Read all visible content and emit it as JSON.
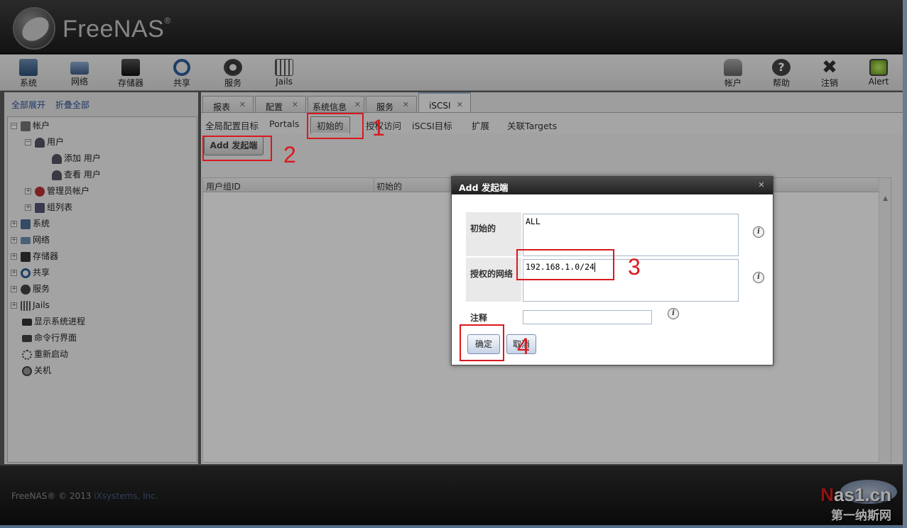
{
  "app": {
    "logo_text": "FreeNAS",
    "logo_reg": "®"
  },
  "toolbar": {
    "left": [
      {
        "label": "系统",
        "icon": "system-icon"
      },
      {
        "label": "网络",
        "icon": "network-icon"
      },
      {
        "label": "存储器",
        "icon": "storage-icon"
      },
      {
        "label": "共享",
        "icon": "sharing-icon"
      },
      {
        "label": "服务",
        "icon": "services-icon"
      },
      {
        "label": "Jails",
        "icon": "jails-icon"
      }
    ],
    "right": [
      {
        "label": "帐户",
        "icon": "account-icon"
      },
      {
        "label": "帮助",
        "icon": "help-icon"
      },
      {
        "label": "注销",
        "icon": "logout-icon"
      },
      {
        "label": "Alert",
        "icon": "alert-icon"
      }
    ]
  },
  "sidebar": {
    "expand_all": "全部展开",
    "collapse_all": "折叠全部",
    "tree": [
      {
        "label": "帐户",
        "toggle": "−"
      },
      {
        "label": "用户",
        "toggle": "−"
      },
      {
        "label": "添加 用户",
        "toggle": ""
      },
      {
        "label": "查看 用户",
        "toggle": ""
      },
      {
        "label": "管理员帐户",
        "toggle": "+"
      },
      {
        "label": "组列表",
        "toggle": "+"
      },
      {
        "label": "系统",
        "toggle": "+"
      },
      {
        "label": "网络",
        "toggle": "+"
      },
      {
        "label": "存储器",
        "toggle": "+"
      },
      {
        "label": "共享",
        "toggle": "+"
      },
      {
        "label": "服务",
        "toggle": "+"
      },
      {
        "label": "Jails",
        "toggle": "+"
      },
      {
        "label": "显示系统进程",
        "toggle": ""
      },
      {
        "label": "命令行界面",
        "toggle": ""
      },
      {
        "label": "重新启动",
        "toggle": ""
      },
      {
        "label": "关机",
        "toggle": ""
      }
    ]
  },
  "tabs": [
    {
      "label": "报表",
      "close": "✕"
    },
    {
      "label": "配置",
      "close": "✕"
    },
    {
      "label": "系统信息",
      "close": "✕"
    },
    {
      "label": "服务",
      "close": "✕"
    },
    {
      "label": "iSCSI",
      "close": "✕"
    }
  ],
  "subtabs": [
    "全局配置目标",
    "Portals",
    "初始的",
    "授权访问",
    "iSCSI目标",
    "扩展",
    "关联Targets"
  ],
  "content": {
    "add_button": "Add 发起端",
    "grid_columns": [
      "用户组ID",
      "初始的"
    ]
  },
  "dialog": {
    "title": "Add 发起端",
    "close": "✕",
    "fields": [
      {
        "label": "初始的",
        "value": "ALL"
      },
      {
        "label": "授权的网络",
        "value": "192.168.1.0/24"
      },
      {
        "label": "注释",
        "value": ""
      }
    ],
    "info_glyph": "i",
    "ok_button": "确定",
    "cancel_button": "取消"
  },
  "annotations": [
    "1",
    "2",
    "3",
    "4"
  ],
  "footer": {
    "copyright": "FreeNAS® © 2013 ",
    "company": "iXsystems, Inc."
  },
  "watermark": {
    "line1_red": "N",
    "line1_rest": "as1.cn",
    "line2": "第一纳斯网"
  },
  "colors": {
    "annotation_red": "#d9191e",
    "link_blue": "#2a4f9a"
  }
}
